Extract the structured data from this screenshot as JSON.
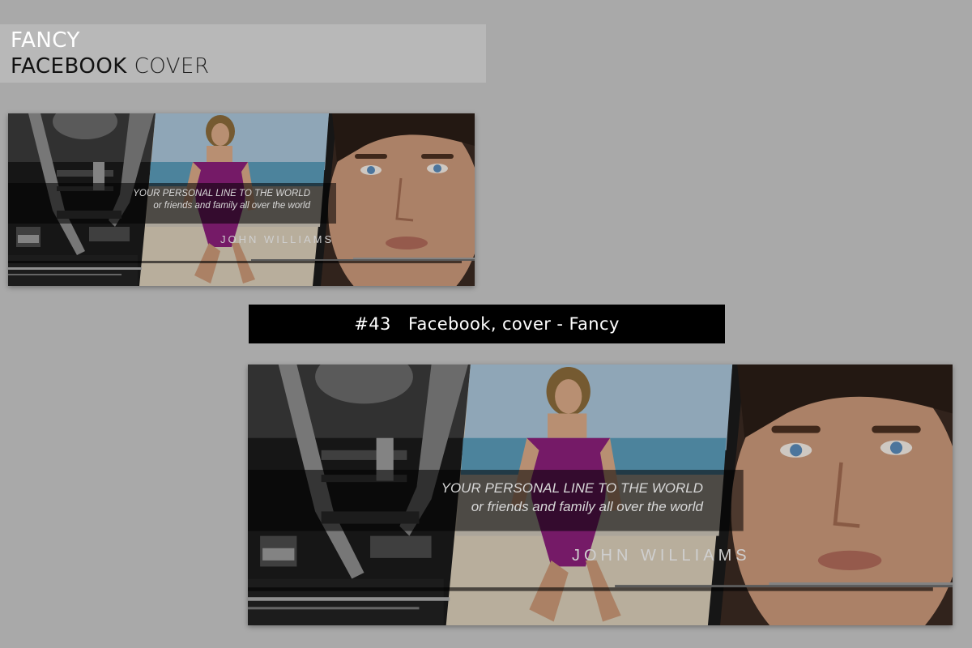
{
  "header": {
    "line1": "FANCY",
    "line2_bold": "FACEBOOK",
    "line2_light": "COVER"
  },
  "label": {
    "text": "#43   Facebook, cover - Fancy"
  },
  "cover": {
    "tagline_line1": "YOUR PERSONAL LINE TO THE WORLD",
    "tagline_line2": "or friends and family all over the world",
    "name": "JOHN WILLIAMS"
  },
  "colors": {
    "background": "#a9a9a9",
    "swimsuit": "#8a1f7a",
    "sky": "#a9c4d8",
    "sea": "#5a9ab8",
    "sand": "#d9cdb8"
  }
}
